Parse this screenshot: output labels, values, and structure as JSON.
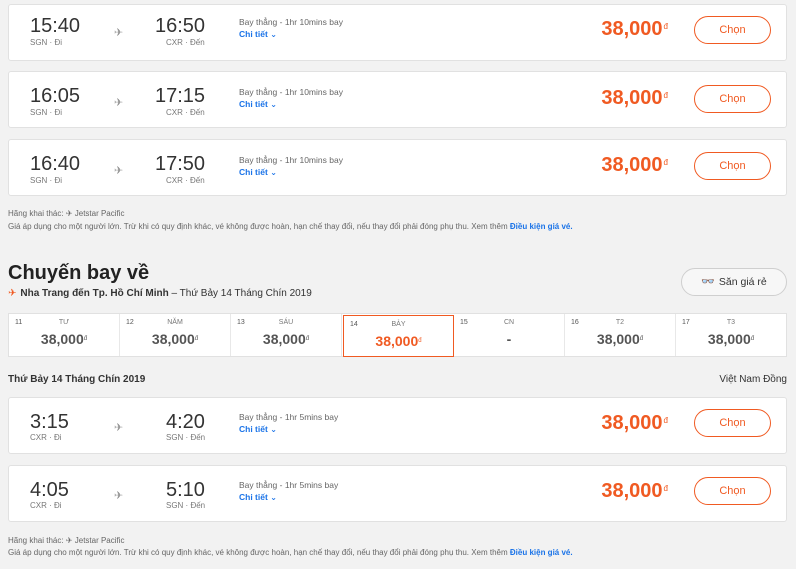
{
  "outbound": [
    {
      "dep_time": "15:40",
      "dep_code": "SGN · Đi",
      "arr_time": "16:50",
      "arr_code": "CXR · Đến",
      "meta": "Bay thẳng - 1hr 10mins bay",
      "detail": "Chi tiết",
      "price": "38,000",
      "currency_symbol": "đ",
      "choose": "Chọn"
    },
    {
      "dep_time": "16:05",
      "dep_code": "SGN · Đi",
      "arr_time": "17:15",
      "arr_code": "CXR · Đến",
      "meta": "Bay thẳng - 1hr 10mins bay",
      "detail": "Chi tiết",
      "price": "38,000",
      "currency_symbol": "đ",
      "choose": "Chọn"
    },
    {
      "dep_time": "16:40",
      "dep_code": "SGN · Đi",
      "arr_time": "17:50",
      "arr_code": "CXR · Đến",
      "meta": "Bay thẳng - 1hr 10mins bay",
      "detail": "Chi tiết",
      "price": "38,000",
      "currency_symbol": "đ",
      "choose": "Chọn"
    }
  ],
  "outbound_note": {
    "operator": "Hãng khai thác: ✈ Jetstar Pacific",
    "terms": "Giá áp dụng cho một người lớn. Trừ khi có quy định khác, vé không được hoàn, hạn chế thay đổi, nếu thay đổi phải đóng phụ thu. Xem thêm ",
    "link": "Điều kiện giá vé."
  },
  "return_section": {
    "title": "Chuyến bay về",
    "route_bold": "Nha Trang đến Tp. Hồ Chí Minh",
    "route_rest": " – Thứ Bảy 14 Tháng Chín 2019",
    "cheap_button": "Săn giá rẻ"
  },
  "date_bar": [
    {
      "num": "11",
      "dow": "TƯ",
      "price": "38,000",
      "sym": "đ",
      "active": false
    },
    {
      "num": "12",
      "dow": "NĂM",
      "price": "38,000",
      "sym": "đ",
      "active": false
    },
    {
      "num": "13",
      "dow": "SÁU",
      "price": "38,000",
      "sym": "đ",
      "active": false
    },
    {
      "num": "14",
      "dow": "BẢY",
      "price": "38,000",
      "sym": "đ",
      "active": true
    },
    {
      "num": "15",
      "dow": "CN",
      "price": "-",
      "sym": "",
      "active": false
    },
    {
      "num": "16",
      "dow": "T2",
      "price": "38,000",
      "sym": "đ",
      "active": false
    },
    {
      "num": "17",
      "dow": "T3",
      "price": "38,000",
      "sym": "đ",
      "active": false
    }
  ],
  "return_header": {
    "date": "Thứ Bảy 14 Tháng Chín 2019",
    "currency": "Việt Nam Đồng"
  },
  "return_flights": [
    {
      "dep_time": "3:15",
      "dep_code": "CXR · Đi",
      "arr_time": "4:20",
      "arr_code": "SGN · Đến",
      "meta": "Bay thẳng - 1hr 5mins bay",
      "detail": "Chi tiết",
      "price": "38,000",
      "currency_symbol": "đ",
      "choose": "Chọn"
    },
    {
      "dep_time": "4:05",
      "dep_code": "CXR · Đi",
      "arr_time": "5:10",
      "arr_code": "SGN · Đến",
      "meta": "Bay thẳng - 1hr 5mins bay",
      "detail": "Chi tiết",
      "price": "38,000",
      "currency_symbol": "đ",
      "choose": "Chọn"
    }
  ],
  "return_note": {
    "operator": "Hãng khai thác: ✈ Jetstar Pacific",
    "terms": "Giá áp dụng cho một người lớn. Trừ khi có quy định khác, vé không được hoàn, hạn chế thay đổi, nếu thay đổi phải đóng phụ thu. Xem thêm ",
    "link": "Điều kiện giá vé."
  },
  "colors": {
    "accent": "#f05a22",
    "link": "#1a73e8"
  },
  "icons": {
    "plane": "plane-icon",
    "chevron": "chevron-down-icon",
    "binoculars": "binoculars-icon"
  }
}
